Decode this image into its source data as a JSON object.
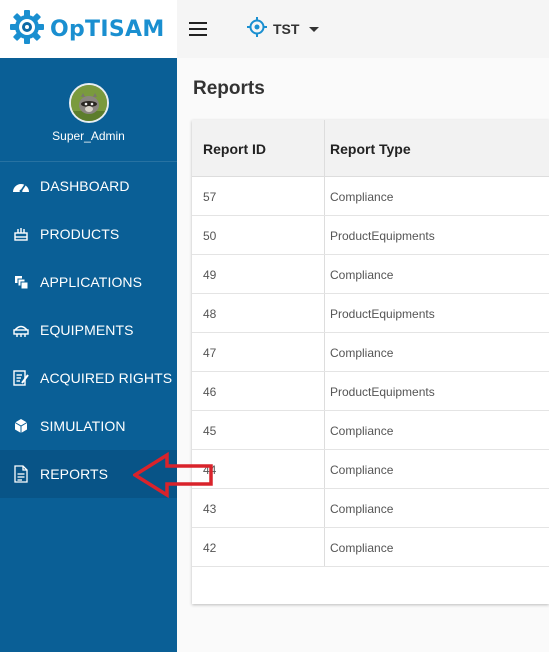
{
  "app": {
    "logo_text": "OpTISAM"
  },
  "topbar": {
    "scope_label": "TST"
  },
  "user": {
    "name": "Super_Admin"
  },
  "sidebar": {
    "items": [
      {
        "label": "DASHBOARD",
        "icon": "dashboard-icon"
      },
      {
        "label": "PRODUCTS",
        "icon": "products-icon"
      },
      {
        "label": "APPLICATIONS",
        "icon": "applications-icon"
      },
      {
        "label": "EQUIPMENTS",
        "icon": "equipments-icon"
      },
      {
        "label": "ACQUIRED RIGHTS",
        "icon": "acquired-rights-icon"
      },
      {
        "label": "SIMULATION",
        "icon": "simulation-icon"
      },
      {
        "label": "REPORTS",
        "icon": "reports-icon",
        "active": true
      }
    ]
  },
  "main": {
    "title": "Reports",
    "table": {
      "headers": [
        "Report ID",
        "Report Type"
      ],
      "rows": [
        {
          "id": "57",
          "type": "Compliance"
        },
        {
          "id": "50",
          "type": "ProductEquipments"
        },
        {
          "id": "49",
          "type": "Compliance"
        },
        {
          "id": "48",
          "type": "ProductEquipments"
        },
        {
          "id": "47",
          "type": "Compliance"
        },
        {
          "id": "46",
          "type": "ProductEquipments"
        },
        {
          "id": "45",
          "type": "Compliance"
        },
        {
          "id": "44",
          "type": "Compliance"
        },
        {
          "id": "43",
          "type": "Compliance"
        },
        {
          "id": "42",
          "type": "Compliance"
        }
      ]
    }
  },
  "colors": {
    "sidebar": "#0a5f96",
    "sidebar_active": "#085487",
    "logo": "#1a8fd0",
    "annotation_arrow": "#d9232b"
  },
  "annotation": {
    "type": "arrow",
    "points_to": "REPORTS"
  }
}
